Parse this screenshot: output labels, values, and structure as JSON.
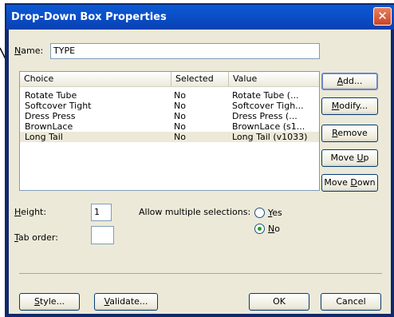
{
  "window": {
    "title": "Drop-Down Box Properties",
    "close_glyph": "✕"
  },
  "name_field": {
    "label_u": "N",
    "label_rest": "ame:",
    "value": "TYPE"
  },
  "list": {
    "columns": [
      "Choice",
      "Selected",
      "Value"
    ],
    "rows": [
      {
        "choice": "Rotate Tube",
        "selected": "No",
        "value": "Rotate Tube (..."
      },
      {
        "choice": "Softcover Tight",
        "selected": "No",
        "value": "Softcover Tigh..."
      },
      {
        "choice": "Dress Press",
        "selected": "No",
        "value": "Dress Press  (..."
      },
      {
        "choice": "BrownLace",
        "selected": "No",
        "value": "BrownLace (s1..."
      },
      {
        "choice": "Long Tail",
        "selected": "No",
        "value": "Long Tail (v1033)"
      }
    ]
  },
  "side_buttons": {
    "add_u": "A",
    "add_rest": "dd...",
    "modify_u": "M",
    "modify_rest": "odify...",
    "remove_u": "R",
    "remove_rest": "emove",
    "moveup_pre": "Move ",
    "moveup_u": "U",
    "moveup_rest": "p",
    "movedown_pre": "Move ",
    "movedown_u": "D",
    "movedown_rest": "own"
  },
  "height": {
    "label_u": "H",
    "label_rest": "eight:",
    "value": "1"
  },
  "tab_order": {
    "label_u": "T",
    "label_rest": "ab order:",
    "value": ""
  },
  "multiple": {
    "label": "Allow multiple selections:",
    "yes_u": "Y",
    "yes_rest": "es",
    "no_pre": "N",
    "no_rest": "o",
    "selected": "No"
  },
  "footer": {
    "style_u": "S",
    "style_rest": "tyle...",
    "validate_u": "V",
    "validate_rest": "alidate...",
    "ok": "OK",
    "cancel": "Cancel"
  },
  "colors": {
    "title_bar": "#0b4fc8",
    "dialog_bg": "#ece9d8",
    "frame": "#10296b"
  }
}
